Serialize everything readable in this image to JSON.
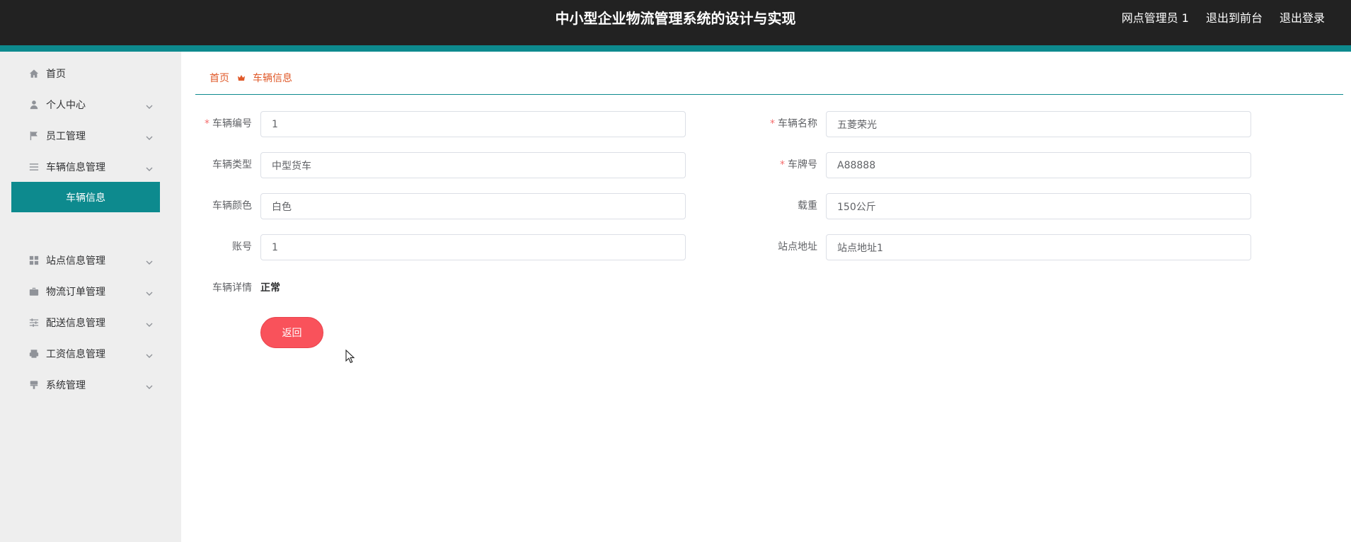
{
  "header": {
    "title": "中小型企业物流管理系统的设计与实现",
    "user_label": "网点管理员 1",
    "exit_front_label": "退出到前台",
    "logout_label": "退出登录"
  },
  "sidebar": {
    "items": [
      {
        "label": "首页",
        "icon": "home-icon"
      },
      {
        "label": "个人中心",
        "icon": "user-icon"
      },
      {
        "label": "员工管理",
        "icon": "flag-icon"
      },
      {
        "label": "车辆信息管理",
        "icon": "menu-icon"
      },
      {
        "label": "站点信息管理",
        "icon": "grid-icon"
      },
      {
        "label": "物流订单管理",
        "icon": "briefcase-icon"
      },
      {
        "label": "配送信息管理",
        "icon": "sliders-icon"
      },
      {
        "label": "工资信息管理",
        "icon": "printer-icon"
      },
      {
        "label": "系统管理",
        "icon": "brush-icon"
      }
    ],
    "active_submenu": "车辆信息"
  },
  "breadcrumb": {
    "home": "首页",
    "current": "车辆信息"
  },
  "form": {
    "vehicle_no": {
      "label": "车辆编号",
      "value": "1",
      "required": true
    },
    "vehicle_name": {
      "label": "车辆名称",
      "value": "五菱荣光",
      "required": true
    },
    "vehicle_type": {
      "label": "车辆类型",
      "value": "中型货车",
      "required": false
    },
    "plate_no": {
      "label": "车牌号",
      "value": "A88888",
      "required": true
    },
    "vehicle_color": {
      "label": "车辆颜色",
      "value": "白色",
      "required": false
    },
    "load": {
      "label": "载重",
      "value": "150公斤",
      "required": false
    },
    "account": {
      "label": "账号",
      "value": "1",
      "required": false
    },
    "station_address": {
      "label": "站点地址",
      "value": "站点地址1",
      "required": false
    },
    "details": {
      "label": "车辆详情",
      "value": "正常"
    }
  },
  "actions": {
    "back_label": "返回"
  },
  "colors": {
    "header_bg": "#222222",
    "accent": "#0d8a8e",
    "breadcrumb": "#e05a2a",
    "button": "#f9525b",
    "required": "#f56c6c"
  }
}
